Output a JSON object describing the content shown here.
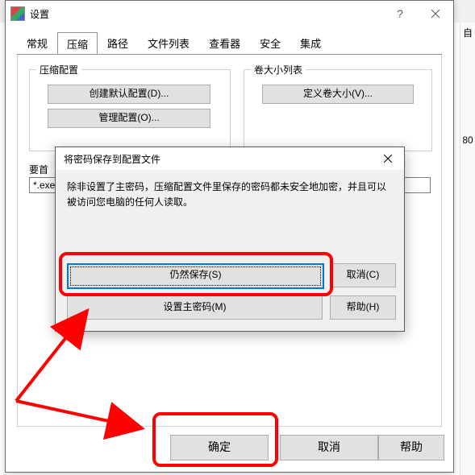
{
  "bg": {
    "side_labels": [
      "自",
      "80"
    ]
  },
  "settings": {
    "title": "设置",
    "tabs": [
      "常规",
      "压缩",
      "路径",
      "文件列表",
      "查看器",
      "安全",
      "集成"
    ],
    "active_tab": 1,
    "group_compress": {
      "title": "压缩配置",
      "create_default": "创建默认配置(D)...",
      "manage": "管理配置(O)..."
    },
    "group_volume": {
      "title": "卷大小列表",
      "define": "定义卷大小(V)..."
    },
    "prefix_label": "要首",
    "prefix_value": "*.exe",
    "ok": "确定",
    "cancel": "取消",
    "help": "帮助"
  },
  "dialog": {
    "title": "将密码保存到配置文件",
    "text": "除非设置了主密码，压缩配置文件里保存的密码都未安全地加密，并且可以被访问您电脑的任何人读取。",
    "save": "仍然保存(S)",
    "master": "设置主密码(M)",
    "cancel": "取消(C)",
    "help": "帮助(H)"
  }
}
